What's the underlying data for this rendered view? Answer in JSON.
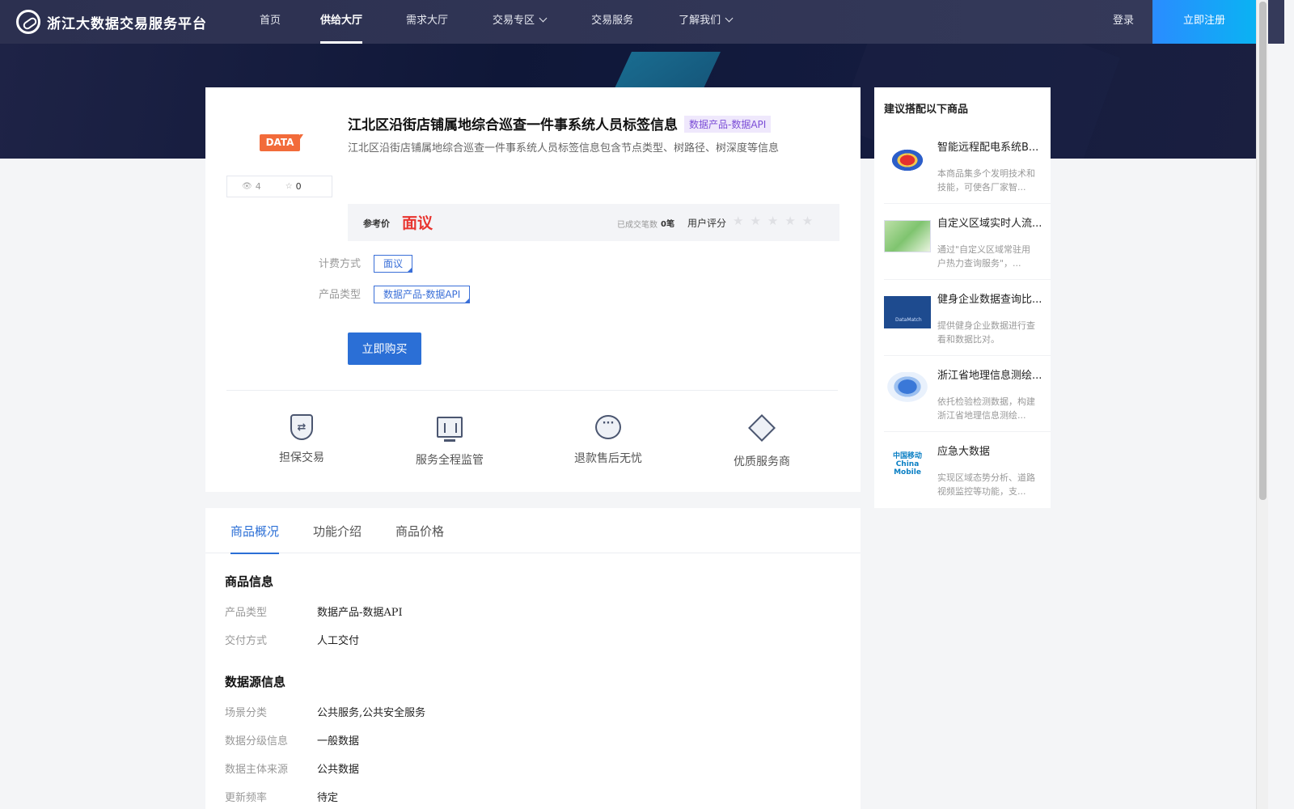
{
  "header": {
    "logo_text": "浙江大数据交易服务平台",
    "nav": [
      {
        "label": "首页",
        "active": false
      },
      {
        "label": "供给大厅",
        "active": true
      },
      {
        "label": "需求大厅",
        "active": false
      },
      {
        "label": "交易专区",
        "active": false,
        "dropdown": true
      },
      {
        "label": "交易服务",
        "active": false
      },
      {
        "label": "了解我们",
        "active": false,
        "dropdown": true
      }
    ],
    "login_label": "登录",
    "register_label": "立即注册"
  },
  "product": {
    "badge": "DATA",
    "views": "4",
    "favorites": "0",
    "title": "江北区沿街店铺属地综合巡查一件事系统人员标签信息",
    "title_tag": "数据产品-数据API",
    "description": "江北区沿街店铺属地综合巡查一件事系统人员标签信息包含节点类型、树路径、树深度等信息",
    "price_label": "参考价",
    "price_value": "面议",
    "deal_count_label": "已成交笔数",
    "deal_count_value": "0笔",
    "rating_label": "用户评分",
    "rating_stars": "★★★★★",
    "billing_label": "计费方式",
    "billing_value": "面议",
    "type_label": "产品类型",
    "type_value": "数据产品-数据API",
    "buy_label": "立即购买"
  },
  "features": [
    {
      "label": "担保交易",
      "icon": "shield-exchange-icon"
    },
    {
      "label": "服务全程监管",
      "icon": "monitor-chart-icon"
    },
    {
      "label": "退款售后无忧",
      "icon": "chat-bubble-icon"
    },
    {
      "label": "优质服务商",
      "icon": "diamond-check-icon"
    }
  ],
  "recommend": {
    "title": "建议搭配以下商品",
    "items": [
      {
        "name": "智能远程配电系统B...",
        "desc": "本商品集多个发明技术和技能，可使各厂家智..."
      },
      {
        "name": "自定义区域实时人流...",
        "desc": "通过\"自定义区域常驻用户热力查询服务\"，..."
      },
      {
        "name": "健身企业数据查询比...",
        "desc": "提供健身企业数据进行查看和数据比对。"
      },
      {
        "name": "浙江省地理信息测绘...",
        "desc": "依托检验检测数据，构建浙江省地理信息测绘..."
      },
      {
        "name": "应急大数据",
        "desc": "实现区域态势分析、道路视频监控等功能，支..."
      }
    ],
    "logo_text_5": "中国移动 China Mobile"
  },
  "tabs": [
    {
      "label": "商品概况",
      "active": true
    },
    {
      "label": "功能介绍",
      "active": false
    },
    {
      "label": "商品价格",
      "active": false
    }
  ],
  "info": {
    "section1_title": "商品信息",
    "rows1": [
      {
        "label": "产品类型",
        "value": "数据产品-数据API"
      },
      {
        "label": "交付方式",
        "value": "人工交付"
      }
    ],
    "section2_title": "数据源信息",
    "rows2": [
      {
        "label": "场景分类",
        "value": "公共服务,公共安全服务"
      },
      {
        "label": "数据分级信息",
        "value": "一般数据"
      },
      {
        "label": "数据主体来源",
        "value": "公共数据"
      },
      {
        "label": "更新频率",
        "value": "待定"
      }
    ]
  }
}
